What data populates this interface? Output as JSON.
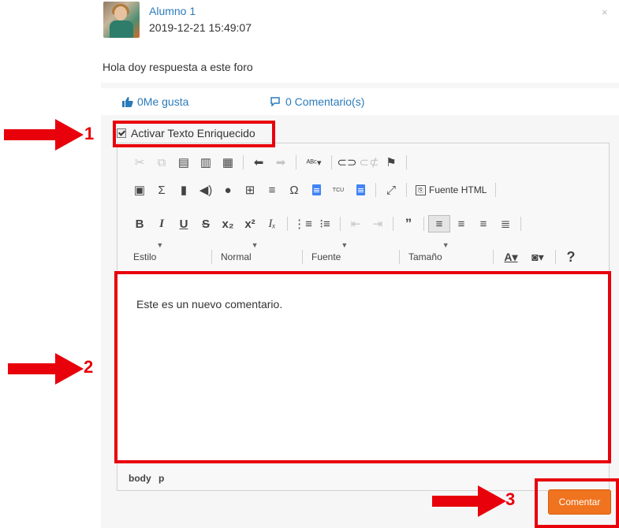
{
  "post": {
    "author": "Alumno 1",
    "date": "2019-12-21 15:49:07",
    "close": "×",
    "body": "Hola doy respuesta a este foro",
    "likes": "0Me gusta",
    "comments": "0 Comentario(s)"
  },
  "editor": {
    "rich_text_toggle": "Activar Texto Enriquecido",
    "rich_text_checked": true,
    "source_label": "Fuente HTML",
    "format_combos": {
      "style": "Estilo",
      "format": "Normal",
      "font": "Fuente",
      "size": "Tamaño"
    },
    "content": "Este es un nuevo comentario.",
    "path": "body p"
  },
  "submit_label": "Comentar",
  "annotations": [
    "1",
    "2",
    "3"
  ],
  "colors": {
    "link": "#2b7bb9",
    "submit": "#f0731f",
    "annotation": "#e8000b"
  }
}
